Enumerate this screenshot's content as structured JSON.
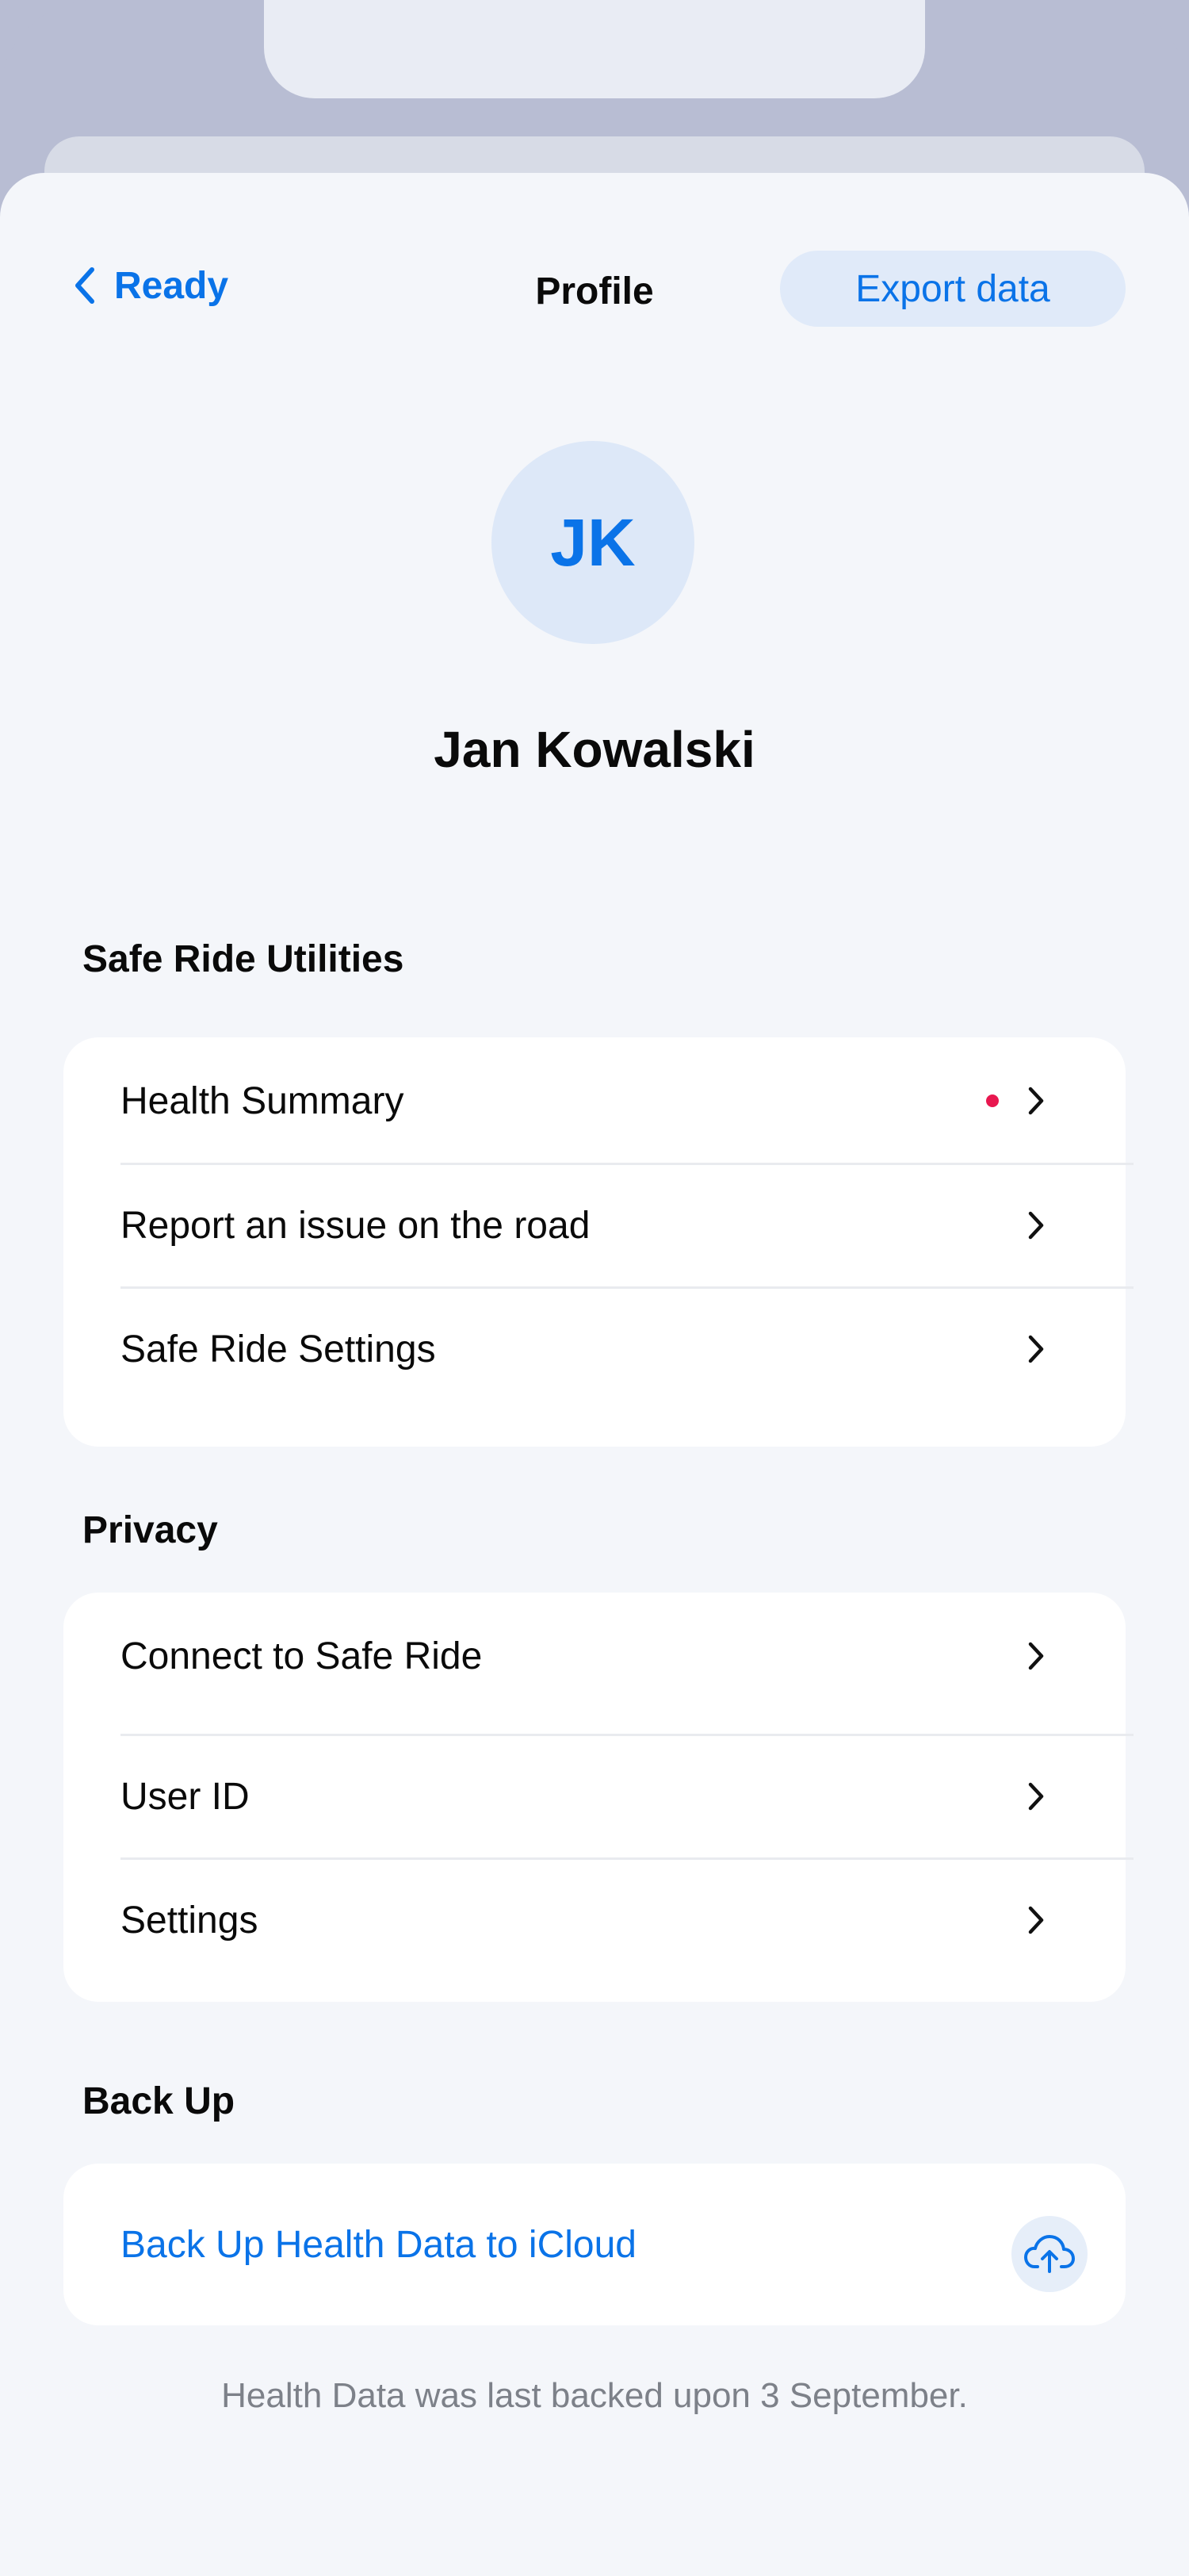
{
  "header": {
    "back_label": "Ready",
    "title": "Profile",
    "export_label": "Export data"
  },
  "profile": {
    "initials": "JK",
    "name": "Jan Kowalski"
  },
  "sections": {
    "utilities": {
      "title": "Safe Ride Utilities",
      "items": [
        {
          "label": "Health Summary",
          "has_notification_dot": true
        },
        {
          "label": "Report an issue on the road"
        },
        {
          "label": "Safe Ride Settings"
        }
      ]
    },
    "privacy": {
      "title": "Privacy",
      "items": [
        {
          "label": "Connect to Safe Ride"
        },
        {
          "label": "User ID"
        },
        {
          "label": "Settings"
        }
      ]
    },
    "backup": {
      "title": "Back Up",
      "action_label": "Back Up Health Data to iCloud",
      "icon": "cloud-upload-icon",
      "footnote": "Health Data was last backed upon 3 September."
    }
  },
  "colors": {
    "accent": "#0a73e8",
    "notification_dot": "#e8174f",
    "background": "#f4f6fa",
    "frame": "#b8bdd3"
  }
}
